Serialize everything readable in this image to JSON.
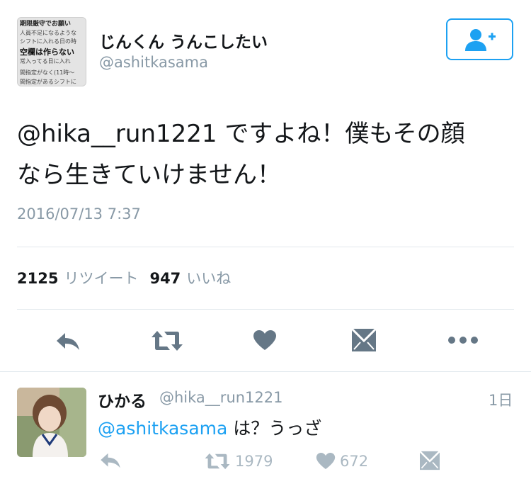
{
  "tweet": {
    "display_name": "じんくん うんこしたい",
    "handle": "@ashitkasama",
    "text_line1": "@hika__run1221 ですよね！僕もその顔",
    "text_line2": "なら生きていけません！",
    "timestamp": "2016/07/13 7:37",
    "retweet_count": "2125",
    "retweet_label": "リツイート",
    "like_count": "947",
    "like_label": "いいね",
    "avatar_text": [
      "期限厳守でお願い",
      "人員不足になるような",
      "シフトに入れる日の時",
      "空欄は作らない",
      "常入ってる日に入れ",
      "間指定がなく(11時〜",
      "間指定があるシフトに"
    ]
  },
  "reply": {
    "display_name": "ひかる",
    "handle": "@hika__run1221",
    "time": "1日",
    "mention": "@ashitkasama",
    "text": " は？うっざ",
    "retweet_count": "1979",
    "like_count": "672"
  },
  "colors": {
    "accent": "#1da1f2",
    "muted": "#8899a6",
    "icon": "#657786",
    "icon_light": "#aab8c2",
    "divider": "#e1e8ed"
  },
  "icons": {
    "follow": "add-user-icon",
    "reply": "reply-icon",
    "retweet": "retweet-icon",
    "like": "heart-icon",
    "dm": "envelope-icon",
    "more": "more-icon"
  }
}
